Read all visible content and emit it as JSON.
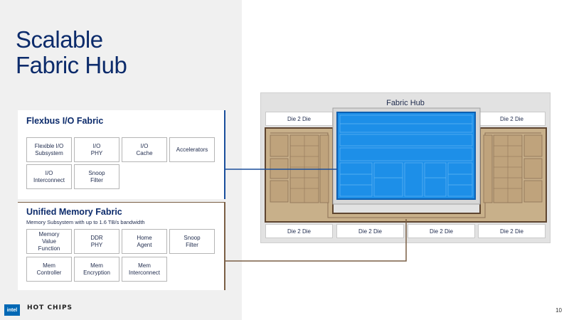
{
  "title_lines": [
    "Scalable",
    "Fabric Hub"
  ],
  "flexbus": {
    "title": "Flexbus I/O Fabric",
    "cells": [
      "Flexible I/O\nSubsystem",
      "I/O\nPHY",
      "I/O\nCache",
      "Accelerators",
      "I/O\nInterconnect",
      "Snoop\nFilter"
    ]
  },
  "umf": {
    "title": "Unified Memory Fabric",
    "subtitle": "Memory Subsystem with up to 1.6 TB/s bandwidth",
    "cells": [
      "Memory\nValue\nFunction",
      "DDR\nPHY",
      "Home\nAgent",
      "Snoop\nFilter",
      "Mem\nController",
      "Mem\nEncryption",
      "Mem\nInterconnect"
    ]
  },
  "hub": {
    "title": "Fabric Hub",
    "die_labels": [
      "Die 2 Die",
      "Die 2 Die",
      "Die 2 Die",
      "Die 2 Die",
      "Die 2 Die",
      "Die 2 Die"
    ]
  },
  "footer": {
    "intel_logo": "intel",
    "hotchips_logo": "HOT CHIPS",
    "page_number": "10"
  },
  "colors": {
    "title": "#0c2b6b",
    "io_link": "#1a4f9c",
    "mem_link": "#7a5f45",
    "hub_blue": "#1d8fe8",
    "die_tan": "#c8b08a"
  }
}
